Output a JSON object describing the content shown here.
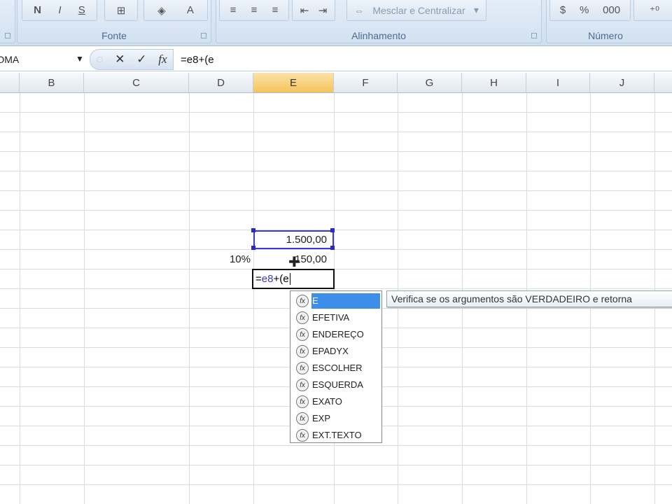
{
  "ribbon": {
    "font_group": {
      "label": "Fonte",
      "bold": "N",
      "italic": "I",
      "underline": "S"
    },
    "alignment_group": {
      "label": "Alinhamento",
      "merge_label": "Mesclar e Centralizar"
    },
    "number_group": {
      "label": "Número",
      "percent": "%",
      "thousands": "000"
    }
  },
  "formula_bar": {
    "name_box": "SOMA",
    "formula": "=e8+(e",
    "cancel": "✕",
    "enter": "✓",
    "fx": "fx"
  },
  "columns": [
    "B",
    "C",
    "D",
    "E",
    "F",
    "G",
    "H",
    "I",
    "J"
  ],
  "selected_column": "E",
  "cells": {
    "e8": "1.500,00",
    "d9": "10%",
    "e9": "150,00",
    "e10_edit_prefix": "=",
    "e10_edit_ref": "e8",
    "e10_edit_rest": "+(e"
  },
  "autocomplete": {
    "items": [
      "E",
      "EFETIVA",
      "ENDEREÇO",
      "EPADYX",
      "ESCOLHER",
      "ESQUERDA",
      "EXATO",
      "EXP",
      "EXT.TEXTO"
    ],
    "selected": "E"
  },
  "tooltip": "Verifica se os argumentos são VERDADEIRO e retorna",
  "colors": {
    "accent": "#3d8ee8",
    "ref": "#3a3adb",
    "selected_header": "#f5c35a"
  }
}
